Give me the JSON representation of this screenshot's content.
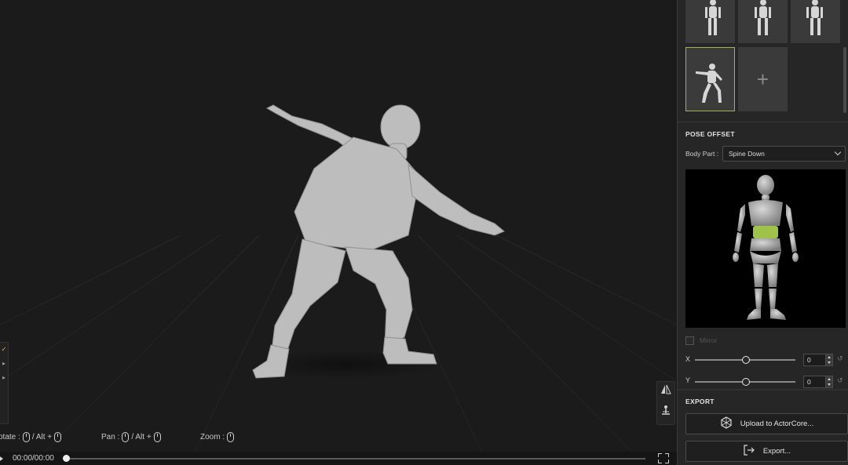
{
  "viewport": {
    "left_tools": [
      "✓",
      "▸",
      "▸"
    ],
    "right_tools": {
      "mirror_icon": "mirror-icon",
      "anchor_icon": "anchor-icon"
    },
    "hints": {
      "rotate": "otate :",
      "rotate_alt": "/  Alt +",
      "pan": "Pan :",
      "pan_alt": "/  Alt +",
      "zoom": "Zoom :"
    },
    "timeline": {
      "time": "00:00/00:00",
      "progress": 0
    }
  },
  "panel": {
    "add_symbol": "+",
    "pose_offset": {
      "title": "POSE OFFSET",
      "body_part_label": "Body Part :",
      "body_part_value": "Spine Down",
      "highlight_color": "#9fc24a",
      "mirror_label": "Mirror",
      "x_label": "X",
      "x_value": "0",
      "y_label": "Y",
      "y_value": "0"
    },
    "export": {
      "title": "EXPORT",
      "upload_label": "Upload to ActorCore...",
      "export_label": "Export..."
    }
  }
}
